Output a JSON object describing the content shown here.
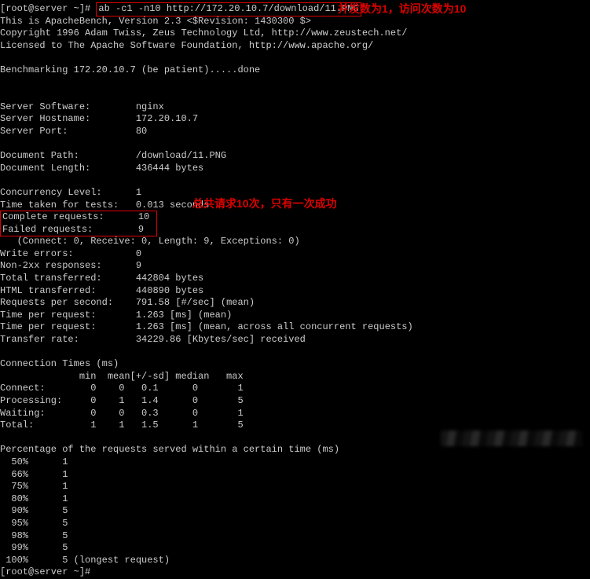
{
  "cmd": {
    "prompt": "[root@server ~]#",
    "command": "ab -c1 -n10 http://172.20.10.7/download/11.PNG"
  },
  "annotations": {
    "top": "并发数为1，访问次数为10",
    "mid": "总共请求10次，只有一次成功"
  },
  "header": {
    "l1": "This is ApacheBench, Version 2.3 <$Revision: 1430300 $>",
    "l2": "Copyright 1996 Adam Twiss, Zeus Technology Ltd, http://www.zeustech.net/",
    "l3": "Licensed to The Apache Software Foundation, http://www.apache.org/",
    "bench": "Benchmarking 172.20.10.7 (be patient).....done"
  },
  "server": {
    "software_k": "Server Software:",
    "software_v": "nginx",
    "hostname_k": "Server Hostname:",
    "hostname_v": "172.20.10.7",
    "port_k": "Server Port:",
    "port_v": "80"
  },
  "doc": {
    "path_k": "Document Path:",
    "path_v": "/download/11.PNG",
    "len_k": "Document Length:",
    "len_v": "436444 bytes"
  },
  "res": {
    "concur_k": "Concurrency Level:",
    "concur_v": "1",
    "time_k": "Time taken for tests:",
    "time_v": "0.013 seconds",
    "complete_k": "Complete requests:",
    "complete_v": "10",
    "failed_k": "Failed requests:",
    "failed_v": "9",
    "failed_detail": "   (Connect: 0, Receive: 0, Length: 9, Exceptions: 0)",
    "write_k": "Write errors:",
    "write_v": "0",
    "non2xx_k": "Non-2xx responses:",
    "non2xx_v": "9",
    "total_k": "Total transferred:",
    "total_v": "442804 bytes",
    "html_k": "HTML transferred:",
    "html_v": "440890 bytes",
    "rps_k": "Requests per second:",
    "rps_v": "791.58 [#/sec] (mean)",
    "tpr1_k": "Time per request:",
    "tpr1_v": "1.263 [ms] (mean)",
    "tpr2_k": "Time per request:",
    "tpr2_v": "1.263 [ms] (mean, across all concurrent requests)",
    "rate_k": "Transfer rate:",
    "rate_v": "34229.86 [Kbytes/sec] received"
  },
  "conn": {
    "title": "Connection Times (ms)",
    "hdr": "              min  mean[+/-sd] median   max",
    "connect": "Connect:        0    0   0.1      0       1",
    "process": "Processing:     0    1   1.4      0       5",
    "waiting": "Waiting:        0    0   0.3      0       1",
    "total": "Total:          1    1   1.5      1       5"
  },
  "pct": {
    "title": "Percentage of the requests served within a certain time (ms)",
    "p50": "  50%      1",
    "p66": "  66%      1",
    "p75": "  75%      1",
    "p80": "  80%      1",
    "p90": "  90%      5",
    "p95": "  95%      5",
    "p98": "  98%      5",
    "p99": "  99%      5",
    "p100": " 100%      5 (longest request)"
  },
  "end_prompt": "[root@server ~]#"
}
